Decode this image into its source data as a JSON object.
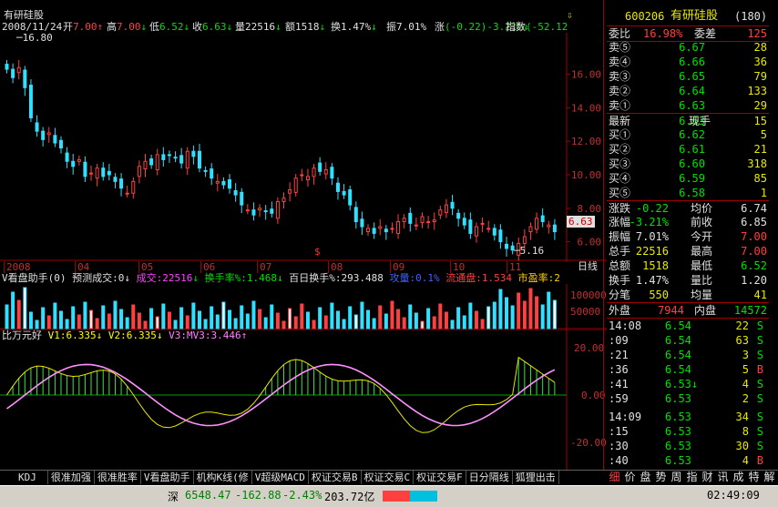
{
  "top": {
    "name": "有研硅股",
    "date": "2008/11/24",
    "open_label": "开",
    "open": "7.00",
    "high_label": "高",
    "high": "7.00",
    "low_label": "低",
    "low": "6.52",
    "close_label": "收",
    "close": "6.63",
    "vol_label": "量",
    "vol": "22516",
    "amt_label": "额",
    "amt": "1518",
    "turn_label": "换",
    "turn": "1.47%",
    "amp_label": "振",
    "amp": "7.01%",
    "chg_label": "涨",
    "chg": "(-0.22)-3.21%",
    "idx_label": "指数",
    "idx": "(-52.12"
  },
  "price_chart": {
    "y_ticks": [
      "16.00",
      "14.00",
      "12.00",
      "10.00",
      "8.00",
      "6.00"
    ],
    "high_mark": "16.80",
    "low_mark": "5.16",
    "current_tag": "6.63",
    "x_ticks": [
      "2008",
      "04",
      "05",
      "06",
      "07",
      "08",
      "09",
      "10",
      "11"
    ],
    "period": "日线"
  },
  "vol_panel": {
    "name": "V看盘助手(0)",
    "predict": "预测成交:0",
    "vol_item": "成交:22516",
    "turn_item": "换手率%:1.468",
    "turn100": "百日换手%:293.488",
    "ratio": "攻量:0.1%",
    "float": "流通盘:1.534",
    "pe": "市盈率:2",
    "y_tick": "100000",
    "y_tick2": "50000"
  },
  "ind_panel": {
    "name": "比万元好",
    "v1": "V1:6.335",
    "v2": "V2:6.335",
    "v3": "V3:MV3:3.446",
    "y_ticks": [
      "20.00",
      "0.00",
      "-20.00"
    ]
  },
  "chart_data": {
    "type": "line",
    "title": "有研硅股",
    "x_ticks": [
      "2008",
      "04",
      "05",
      "06",
      "07",
      "08",
      "09",
      "10",
      "11"
    ],
    "ylim": [
      5.0,
      17.5
    ],
    "close_series": [
      16.3,
      15.8,
      16.4,
      15.2,
      13.4,
      12.6,
      12.1,
      12.5,
      11.9,
      11.6,
      10.8,
      10.5,
      10.9,
      9.9,
      10.1,
      10.4,
      9.9,
      10.0,
      9.6,
      9.2,
      8.9,
      9.6,
      10.5,
      10.8,
      10.6,
      11.2,
      10.9,
      11.2,
      11.0,
      10.7,
      11.4,
      11.1,
      10.4,
      10.2,
      9.8,
      9.6,
      9.4,
      9.2,
      8.8,
      8.2,
      7.9,
      7.6,
      8.0,
      7.8,
      7.7,
      8.4,
      8.6,
      9.1,
      9.8,
      10.0,
      9.9,
      10.4,
      10.2,
      10.3,
      9.8,
      9.0,
      8.8,
      8.2,
      7.2,
      6.9,
      6.8,
      6.5,
      6.9,
      6.6,
      6.8,
      7.2,
      7.4,
      7.1,
      7.0,
      7.5,
      7.2,
      7.3,
      7.9,
      8.2,
      8.0,
      7.4,
      7.0,
      6.5,
      6.9,
      7.1,
      6.8,
      6.4,
      6.0,
      5.6,
      5.5,
      5.9,
      6.3,
      6.9,
      7.4,
      7.2,
      7.0,
      6.6
    ]
  },
  "quote": {
    "code": "600206",
    "name": "有研硅股",
    "num": "(180)",
    "wb_label": "委比",
    "wb": "16.98%",
    "wc_label": "委差",
    "wc": "125",
    "sells": [
      {
        "k": "卖⑤",
        "v": "6.67",
        "n": "28"
      },
      {
        "k": "卖④",
        "v": "6.66",
        "n": "36"
      },
      {
        "k": "卖③",
        "v": "6.65",
        "n": "79"
      },
      {
        "k": "卖②",
        "v": "6.64",
        "n": "133"
      },
      {
        "k": "卖①",
        "v": "6.63",
        "n": "29"
      }
    ],
    "latest_label": "最新",
    "latest": "6.63",
    "xs_label": "现手",
    "xs": "15",
    "buys": [
      {
        "k": "买①",
        "v": "6.62",
        "n": "5"
      },
      {
        "k": "买②",
        "v": "6.61",
        "n": "21"
      },
      {
        "k": "买③",
        "v": "6.60",
        "n": "318"
      },
      {
        "k": "买④",
        "v": "6.59",
        "n": "85"
      },
      {
        "k": "买⑤",
        "v": "6.58",
        "n": "1"
      }
    ],
    "stats": [
      {
        "k1": "涨跌",
        "v1": "-0.22",
        "k2": "均价",
        "v2": "6.74"
      },
      {
        "k1": "涨幅",
        "v1": "-3.21%",
        "k2": "前收",
        "v2": "6.85"
      },
      {
        "k1": "振幅",
        "v1": "7.01%",
        "k2": "今开",
        "v2": "7.00"
      },
      {
        "k1": "总手",
        "v1": "22516",
        "k2": "最高",
        "v2": "7.00"
      },
      {
        "k1": "总额",
        "v1": "1518",
        "k2": "最低",
        "v2": "6.52"
      },
      {
        "k1": "换手",
        "v1": "1.47%",
        "k2": "量比",
        "v2": "1.20"
      },
      {
        "k1": "分笔",
        "v1": "550",
        "k2": "均量",
        "v2": "41"
      }
    ],
    "outer_label": "外盘",
    "outer": "7944",
    "inner_label": "内盘",
    "inner": "14572"
  },
  "ticks": [
    {
      "t": "14:08",
      "p": "6.54",
      "n": "22",
      "s": "S"
    },
    {
      "t": ":09",
      "p": "6.54",
      "n": "63",
      "s": "S"
    },
    {
      "t": ":21",
      "p": "6.54",
      "n": "3",
      "s": "S"
    },
    {
      "t": ":36",
      "p": "6.54",
      "n": "5",
      "s": "B"
    },
    {
      "t": ":41",
      "p": "6.53↓",
      "n": "4",
      "s": "S"
    },
    {
      "t": ":59",
      "p": "6.53",
      "n": "2",
      "s": "S"
    },
    {
      "t": "14:09",
      "p": "6.53",
      "n": "34",
      "s": "S"
    },
    {
      "t": ":15",
      "p": "6.53",
      "n": "8",
      "s": "S"
    },
    {
      "t": ":30",
      "p": "6.53",
      "n": "30",
      "s": "S"
    },
    {
      "t": ":40",
      "p": "6.53",
      "n": "4",
      "s": "B"
    }
  ],
  "tabs": [
    "KDJ",
    "很准加强",
    "很准胜率",
    "V看盘助手",
    "机构K线(修",
    "V超级MACD",
    "权证交易B",
    "权证交易C",
    "权证交易F",
    "日分隔线",
    "狐狸出击"
  ],
  "right_tabs": [
    "细",
    "价",
    "盘",
    "势",
    "周",
    "指",
    "财",
    "讯",
    "成",
    "特",
    "解"
  ],
  "status": {
    "market": "深",
    "index": "6548.47",
    "change": "-162.88",
    "pct": "-2.43%",
    "amount": "203.72亿",
    "time": "02:49:09"
  }
}
